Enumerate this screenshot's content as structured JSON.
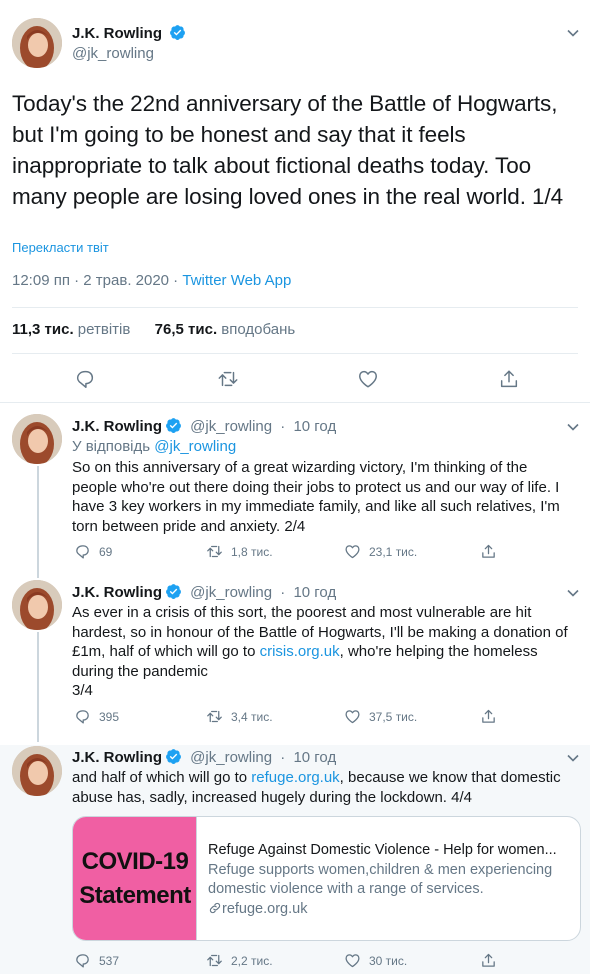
{
  "main_tweet": {
    "name": "J.K. Rowling",
    "handle": "@jk_rowling",
    "text": "Today's the 22nd anniversary of the Battle of Hogwarts, but I'm going to be honest and say that it feels inappropriate to talk about fictional deaths today. Too many people are losing loved ones in the real world. 1/4",
    "translate_label": "Перекласти твіт",
    "time": "12:09 пп · 2 трав. 2020 · ",
    "source": "Twitter Web App",
    "retweets_count": "11,3 тис.",
    "retweets_label": "ретвітів",
    "likes_count": "76,5 тис.",
    "likes_label": "вподобань",
    "actions": [
      "reply-icon",
      "retweet-icon",
      "like-icon",
      "share-icon"
    ]
  },
  "replies": [
    {
      "name": "J.K. Rowling",
      "handle": "@jk_rowling",
      "sep": "·",
      "age": "10 год",
      "reply_to_prefix": "У відповідь ",
      "reply_to_handle": "@jk_rowling",
      "text": "So on this anniversary of a great wizarding victory, I'm thinking of the people who're out there doing their jobs to protect us and our way of life. I have 3 key workers in my immediate family, and like all such relatives, I'm torn between pride and anxiety. 2/4",
      "replies": "69",
      "retweets": "1,8 тис.",
      "likes": "23,1 тис."
    },
    {
      "name": "J.K. Rowling",
      "handle": "@jk_rowling",
      "sep": "·",
      "age": "10 год",
      "text_before": "As ever in a crisis of this sort, the poorest and most vulnerable are hit hardest, so in honour of the Battle of Hogwarts, I'll be making a donation of £1m, half of which will go to ",
      "link": "crisis.org.uk",
      "text_after": ", who're helping the homeless during the pandemic",
      "text_tail": "3/4",
      "replies": "395",
      "retweets": "3,4 тис.",
      "likes": "37,5 тис."
    },
    {
      "name": "J.K. Rowling",
      "handle": "@jk_rowling",
      "sep": "·",
      "age": "10 год",
      "text_before": "and half of which will go to ",
      "link": "refuge.org.uk",
      "text_after": ", because we know that domestic abuse has, sadly, increased hugely during the lockdown. 4/4",
      "replies": "537",
      "retweets": "2,2 тис.",
      "likes": "30 тис."
    }
  ],
  "card": {
    "image_line1": "COVID-19",
    "image_line2": "Statement",
    "title": "Refuge Against Domestic Violence - Help for women...",
    "description": "Refuge supports women,children & men experiencing domestic violence with a range of services.",
    "url": "refuge.org.uk",
    "image_color": "#f05fa3"
  },
  "colors": {
    "link": "#1b95e0",
    "muted": "#657786",
    "highlight_bg": "#f5f8fa"
  }
}
